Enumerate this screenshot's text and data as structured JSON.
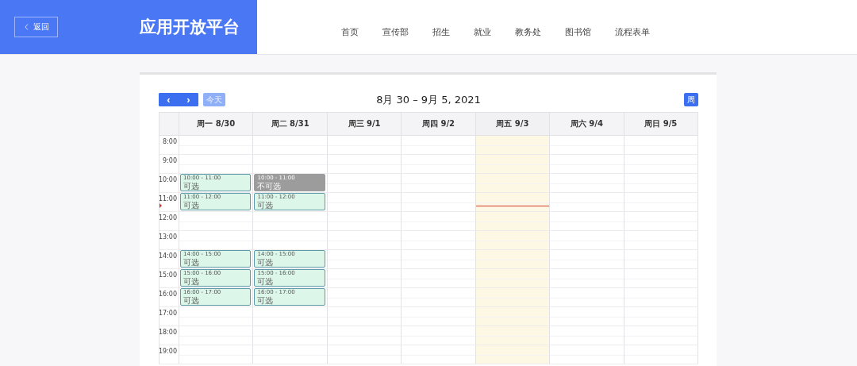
{
  "header": {
    "back_button": "返回",
    "title": "应用开放平台",
    "nav": [
      {
        "label": "首页"
      },
      {
        "label": "宣传部"
      },
      {
        "label": "招生"
      },
      {
        "label": "就业"
      },
      {
        "label": "教务处"
      },
      {
        "label": "图书馆"
      },
      {
        "label": "流程表单"
      }
    ]
  },
  "calendar": {
    "prev_button": "‹",
    "next_button": "›",
    "today_button": "今天",
    "range_title": "8月 30 – 9月 5, 2021",
    "view_button": "周",
    "days": [
      {
        "label": "周一 8/30",
        "today": false
      },
      {
        "label": "周二 8/31",
        "today": false
      },
      {
        "label": "周三 9/1",
        "today": false
      },
      {
        "label": "周四 9/2",
        "today": false
      },
      {
        "label": "周五 9/3",
        "today": true
      },
      {
        "label": "周六 9/4",
        "today": false
      },
      {
        "label": "周日 9/5",
        "today": false
      }
    ],
    "rows": [
      {
        "time": "8:00",
        "now": false,
        "cells": [
          {
            "kind": "empty"
          },
          {
            "kind": "empty"
          },
          {
            "kind": "empty"
          },
          {
            "kind": "empty"
          },
          {
            "kind": "empty"
          },
          {
            "kind": "empty"
          },
          {
            "kind": "empty"
          }
        ]
      },
      {
        "time": "9:00",
        "now": false,
        "cells": [
          {
            "kind": "empty"
          },
          {
            "kind": "empty"
          },
          {
            "kind": "empty"
          },
          {
            "kind": "empty"
          },
          {
            "kind": "empty"
          },
          {
            "kind": "empty"
          },
          {
            "kind": "empty"
          }
        ]
      },
      {
        "time": "10:00",
        "now": false,
        "cells": [
          {
            "kind": "event",
            "selectable": true,
            "time": "10:00 - 11:00",
            "label": "可选"
          },
          {
            "kind": "event",
            "selectable": false,
            "time": "10:00 - 11:00",
            "label": "不可选"
          },
          {
            "kind": "empty"
          },
          {
            "kind": "empty"
          },
          {
            "kind": "empty"
          },
          {
            "kind": "empty"
          },
          {
            "kind": "empty"
          }
        ]
      },
      {
        "time": "11:00",
        "now": true,
        "cells": [
          {
            "kind": "event",
            "selectable": true,
            "time": "11:00 - 12:00",
            "label": "可选"
          },
          {
            "kind": "event",
            "selectable": true,
            "time": "11:00 - 12:00",
            "label": "可选"
          },
          {
            "kind": "empty"
          },
          {
            "kind": "empty"
          },
          {
            "kind": "empty"
          },
          {
            "kind": "empty"
          },
          {
            "kind": "empty"
          }
        ]
      },
      {
        "time": "12:00",
        "now": false,
        "cells": [
          {
            "kind": "empty"
          },
          {
            "kind": "empty"
          },
          {
            "kind": "empty"
          },
          {
            "kind": "empty"
          },
          {
            "kind": "empty"
          },
          {
            "kind": "empty"
          },
          {
            "kind": "empty"
          }
        ]
      },
      {
        "time": "13:00",
        "now": false,
        "cells": [
          {
            "kind": "empty"
          },
          {
            "kind": "empty"
          },
          {
            "kind": "empty"
          },
          {
            "kind": "empty"
          },
          {
            "kind": "empty"
          },
          {
            "kind": "empty"
          },
          {
            "kind": "empty"
          }
        ]
      },
      {
        "time": "14:00",
        "now": false,
        "cells": [
          {
            "kind": "event",
            "selectable": true,
            "time": "14:00 - 15:00",
            "label": "可选"
          },
          {
            "kind": "event",
            "selectable": true,
            "time": "14:00 - 15:00",
            "label": "可选"
          },
          {
            "kind": "empty"
          },
          {
            "kind": "empty"
          },
          {
            "kind": "empty"
          },
          {
            "kind": "empty"
          },
          {
            "kind": "empty"
          }
        ]
      },
      {
        "time": "15:00",
        "now": false,
        "cells": [
          {
            "kind": "event",
            "selectable": true,
            "time": "15:00 - 16:00",
            "label": "可选"
          },
          {
            "kind": "event",
            "selectable": true,
            "time": "15:00 - 16:00",
            "label": "可选"
          },
          {
            "kind": "empty"
          },
          {
            "kind": "empty"
          },
          {
            "kind": "empty"
          },
          {
            "kind": "empty"
          },
          {
            "kind": "empty"
          }
        ]
      },
      {
        "time": "16:00",
        "now": false,
        "cells": [
          {
            "kind": "event",
            "selectable": true,
            "time": "16:00 - 17:00",
            "label": "可选"
          },
          {
            "kind": "event",
            "selectable": true,
            "time": "16:00 - 17:00",
            "label": "可选"
          },
          {
            "kind": "empty"
          },
          {
            "kind": "empty"
          },
          {
            "kind": "empty"
          },
          {
            "kind": "empty"
          },
          {
            "kind": "empty"
          }
        ]
      },
      {
        "time": "17:00",
        "now": false,
        "cells": [
          {
            "kind": "empty"
          },
          {
            "kind": "empty"
          },
          {
            "kind": "empty"
          },
          {
            "kind": "empty"
          },
          {
            "kind": "empty"
          },
          {
            "kind": "empty"
          },
          {
            "kind": "empty"
          }
        ]
      },
      {
        "time": "18:00",
        "now": false,
        "cells": [
          {
            "kind": "empty"
          },
          {
            "kind": "empty"
          },
          {
            "kind": "empty"
          },
          {
            "kind": "empty"
          },
          {
            "kind": "empty"
          },
          {
            "kind": "empty"
          },
          {
            "kind": "empty"
          }
        ]
      },
      {
        "time": "19:00",
        "now": false,
        "cells": [
          {
            "kind": "empty"
          },
          {
            "kind": "empty"
          },
          {
            "kind": "empty"
          },
          {
            "kind": "empty"
          },
          {
            "kind": "empty"
          },
          {
            "kind": "empty"
          },
          {
            "kind": "empty"
          }
        ]
      }
    ]
  }
}
